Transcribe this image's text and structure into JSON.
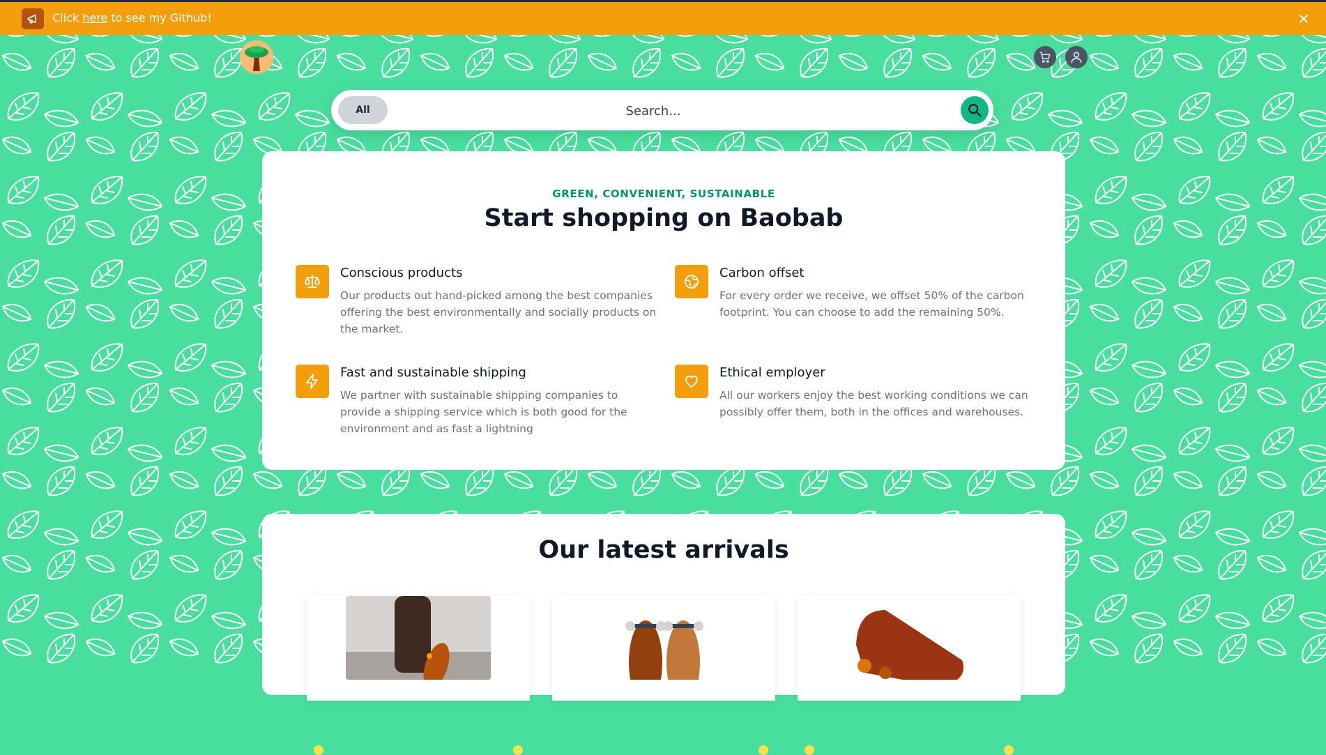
{
  "banner": {
    "text_before": "Click",
    "link_text": "here",
    "text_after": "to see my Github!",
    "color": "#f59e0b"
  },
  "header": {
    "logo_icon": "baobab-tree-logo",
    "cart_icon": "cart-icon",
    "user_icon": "user-icon"
  },
  "search": {
    "category": "All",
    "placeholder": "Search..."
  },
  "hero": {
    "eyebrow": "GREEN, CONVENIENT, SUSTAINABLE",
    "title": "Start shopping on Baobab",
    "features": [
      {
        "icon": "scale-icon",
        "title": "Conscious products",
        "description": "Our products out hand-picked among the best companies offering the best environmentally and socially products on the market."
      },
      {
        "icon": "globe-icon",
        "title": "Carbon offset",
        "description": "For every order we receive, we offset 50% of the carbon footprint. You can choose to add the remaining 50%."
      },
      {
        "icon": "lightning-icon",
        "title": "Fast and sustainable shipping",
        "description": "We partner with sustainable shipping companies to provide a shipping service which is both good for the environment and as fast a lightning"
      },
      {
        "icon": "heart-icon",
        "title": "Ethical employer",
        "description": "All our workers enjoy the best working conditions we can possibly offer them, both in the offices and warehouses."
      }
    ]
  },
  "arrivals": {
    "title": "Our latest arrivals"
  },
  "colors": {
    "background": "#48df9e",
    "accent": "#f59e0b",
    "brand_green": "#10b981",
    "eyebrow": "#059669"
  }
}
